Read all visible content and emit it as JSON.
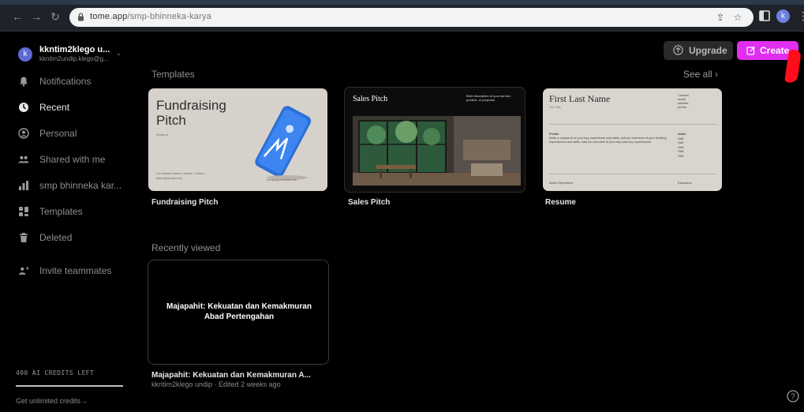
{
  "browser": {
    "url_host": "tome.app",
    "url_path": "/smp-bhinneka-karya",
    "profile_initial": "k"
  },
  "user": {
    "initial": "k",
    "name": "kkntim2klego u...",
    "email": "kkntim2undip.klego@g..."
  },
  "sidebar": {
    "items": [
      {
        "label": "Notifications",
        "icon": "bell-icon"
      },
      {
        "label": "Recent",
        "icon": "clock-icon"
      },
      {
        "label": "Personal",
        "icon": "person-circle-icon"
      },
      {
        "label": "Shared with me",
        "icon": "people-icon"
      },
      {
        "label": "smp bhinneka kar...",
        "icon": "workspace-grid-icon"
      },
      {
        "label": "Templates",
        "icon": "templates-icon"
      },
      {
        "label": "Deleted",
        "icon": "trash-icon"
      },
      {
        "label": "Invite teammates",
        "icon": "add-person-icon"
      }
    ],
    "active": "Recent",
    "credits_label": "400 AI CREDITS LEFT",
    "credits_fraction": 1.0,
    "unlimited_label": "Get unlimited credits→"
  },
  "header": {
    "upgrade_label": "Upgrade",
    "create_label": "Create"
  },
  "templates": {
    "section_title": "Templates",
    "see_all_label": "See all ›",
    "cards": [
      {
        "name": "Fundraising Pitch",
        "heading_line1": "Fundraising",
        "heading_line2": "Pitch",
        "small_text": "Series A",
        "footer_line1": "Co-founder Name • Name • Name •",
        "footer_line2": "Name@email.com",
        "footer_right": "company website link"
      },
      {
        "name": "Sales Pitch",
        "heading": "Sales Pitch",
        "subtitle": "Brief description of your service, product, or proposal"
      },
      {
        "name": "Resume",
        "heading": "First Last Name",
        "sub": "Job Title",
        "contact": "Contact\nemail\nwebsite\nphone",
        "profile_label": "Profile",
        "profile_text": "Write a snapshot of your key experience and skills. Add an overview of your backing experiences and skills. Add an overview of your key and key experiences.",
        "skills_label": "Skills",
        "skills": [
          "Skill",
          "Skill",
          "Skill",
          "Skill",
          "Skill"
        ],
        "work_label": "Work Experience",
        "edu_label": "Education"
      }
    ]
  },
  "recent": {
    "section_title": "Recently viewed",
    "card_heading": "Majapahit: Kekuatan dan Kemakmuran Abad Pertengahan",
    "card_title": "Majapahit: Kekuatan dan Kemakmuran A...",
    "meta": "kkntim2klego undip · Edited 2 weeks ago"
  },
  "colors": {
    "create_accent": "#e12ef0",
    "background": "#000000",
    "annotation_mark": "#ff0d1a"
  }
}
